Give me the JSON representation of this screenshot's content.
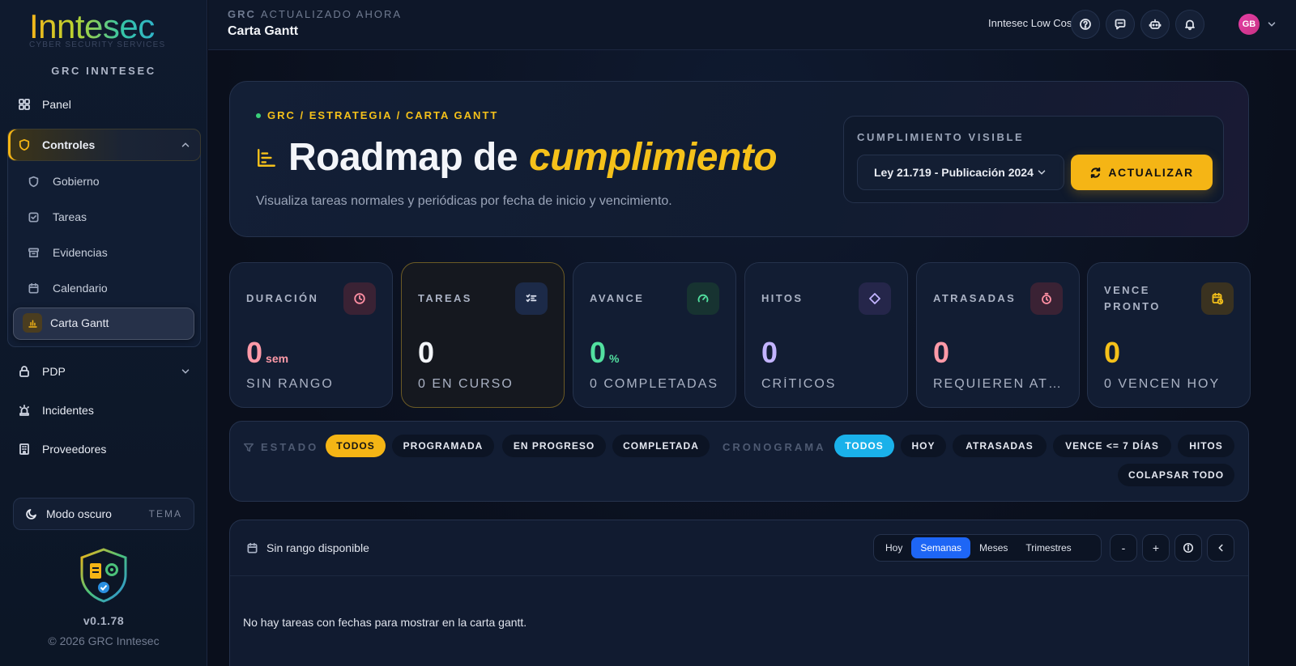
{
  "sidebar": {
    "logo": "Inntesec",
    "logo_sub": "CYBER SECURITY SERVICES",
    "brand": "GRC INNTESEC",
    "items": [
      {
        "label": "Panel"
      },
      {
        "label": "Controles"
      },
      {
        "label": "PDP"
      },
      {
        "label": "Incidentes"
      },
      {
        "label": "Proveedores"
      }
    ],
    "sub_items": [
      {
        "label": "Gobierno"
      },
      {
        "label": "Tareas"
      },
      {
        "label": "Evidencias"
      },
      {
        "label": "Calendario"
      },
      {
        "label": "Carta Gantt"
      }
    ],
    "theme": {
      "label": "Modo oscuro",
      "tag": "TEMA"
    },
    "version": "v0.1.78",
    "copyright": "© 2026 GRC Inntesec"
  },
  "topbar": {
    "crumb": "GRC",
    "status": "ACTUALIZADO AHORA",
    "title": "Carta Gantt",
    "org": "Inntesec Low Cost",
    "avatar": "GB"
  },
  "hero": {
    "crumb": "GRC / ESTRATEGIA / CARTA GANTT",
    "title_a": "Roadmap de",
    "title_b": "cumplimiento",
    "subtitle": "Visualiza tareas normales y periódicas por fecha de inicio y vencimiento.",
    "compliance_label": "CUMPLIMIENTO VISIBLE",
    "selected": "Ley 21.719 - Publicación 2024",
    "update_label": "ACTUALIZAR"
  },
  "cards": [
    {
      "label": "DURACIÓN",
      "value": "0",
      "unit": "sem",
      "foot": "SIN RANGO",
      "color": "#ff9aa8",
      "icon_bg": "#3a2234",
      "icon_color": "#ff8fa3"
    },
    {
      "label": "TAREAS",
      "value": "0",
      "unit": "",
      "foot": "0 EN CURSO",
      "color": "#f3f5f9",
      "icon_bg": "#1c2a48",
      "icon_color": "#d7dcea"
    },
    {
      "label": "AVANCE",
      "value": "0",
      "unit": "%",
      "foot": "0 COMPLETADAS",
      "color": "#52e0a0",
      "icon_bg": "#173331",
      "icon_color": "#52e0a0"
    },
    {
      "label": "HITOS",
      "value": "0",
      "unit": "",
      "foot": "CRÍTICOS",
      "color": "#c3b4ff",
      "icon_bg": "#25264a",
      "icon_color": "#c3b4ff"
    },
    {
      "label": "ATRASADAS",
      "value": "0",
      "unit": "",
      "foot": "REQUIEREN ATENCIÓN",
      "color": "#ff9aa8",
      "icon_bg": "#3a2234",
      "icon_color": "#ff8fa3"
    },
    {
      "label": "VENCE PRONTO",
      "value": "0",
      "unit": "",
      "foot": "0 VENCEN HOY",
      "color": "#f5c11a",
      "icon_bg": "#3a3220",
      "icon_color": "#f5c11a"
    }
  ],
  "filters": {
    "estado_label": "ESTADO",
    "estado": [
      "TODOS",
      "PROGRAMADA",
      "EN PROGRESO",
      "COMPLETADA"
    ],
    "crono_label": "CRONOGRAMA",
    "crono": [
      "TODOS",
      "HOY",
      "ATRASADAS",
      "VENCE <= 7 DÍAS",
      "HITOS"
    ],
    "collapse": "COLAPSAR TODO"
  },
  "gantt": {
    "range": "Sin rango disponible",
    "views": [
      "Hoy",
      "Semanas",
      "Meses",
      "Trimestres"
    ],
    "active_view": "Semanas",
    "zoom_out": "-",
    "zoom_in": "+",
    "empty": "No hay tareas con fechas para mostrar en la carta gantt."
  }
}
